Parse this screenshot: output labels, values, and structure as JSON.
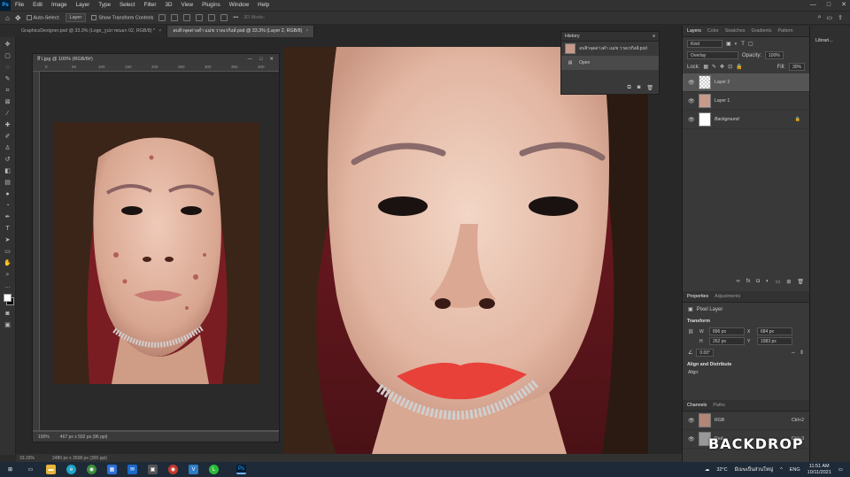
{
  "app": {
    "logo": "Ps"
  },
  "menu": [
    "File",
    "Edit",
    "Image",
    "Layer",
    "Type",
    "Select",
    "Filter",
    "3D",
    "View",
    "Plugins",
    "Window",
    "Help"
  ],
  "window_controls": [
    "—",
    "□",
    "✕"
  ],
  "options": {
    "auto_select_label": "Auto-Select:",
    "auto_select_value": "Layer",
    "show_transform_label": "Show Transform Controls",
    "mode_3d_label": "3D Mode:"
  },
  "tabs": [
    {
      "label": "GraphicsDesigner.psd @ 33.3% (Logo_รูปภาพนอก 02, RGB/8) *",
      "active": false
    },
    {
      "label": "ลบสิวจุดด่างดำ แม่ช วาดเรกิงส์.psd @ 33.3% (Layer 2, RGB/8)",
      "active": true
    }
  ],
  "float_window": {
    "title": "สิว.jpg @ 100% (RGB/8#)",
    "ruler_ticks": [
      "0",
      "50",
      "100",
      "150",
      "200",
      "250",
      "300",
      "350",
      "400"
    ],
    "zoom": "100%",
    "size": "467 px x 592 px (96 ppi)"
  },
  "statusbar": {
    "zoom": "33.33%",
    "size": "2480 px x 3508 px (300 ppi)"
  },
  "history": {
    "title": "History",
    "snapshot": "ลบสิวจุดด่างดำ แม่ช วาดเรกิงส์.psd",
    "step": "Open"
  },
  "layers_panel": {
    "tabs": [
      "Layers",
      "Color",
      "Swatches",
      "Gradients",
      "Pattern"
    ],
    "kind": "Kind",
    "blend_mode": "Overlay",
    "opacity_label": "Opacity:",
    "opacity": "100%",
    "lock_label": "Lock:",
    "fill_label": "Fill:",
    "fill": "30%",
    "layers": [
      {
        "name": "Layer 2",
        "selected": true
      },
      {
        "name": "Layer 1",
        "selected": false
      },
      {
        "name": "Background",
        "selected": false
      }
    ]
  },
  "properties": {
    "tabs": [
      "Properties",
      "Adjustments"
    ],
    "type": "Pixel Layer",
    "transform_title": "Transform",
    "w_label": "W",
    "w": "896 px",
    "h_label": "H",
    "h": "262 px",
    "x_label": "X",
    "x": "684 px",
    "y_label": "Y",
    "y": "1983 px",
    "angle": "0.00°",
    "align_title": "Align and Distribute",
    "align_label": "Align:"
  },
  "channels": {
    "tabs": [
      "Channels",
      "Paths"
    ],
    "items": [
      {
        "name": "RGB",
        "shortcut": "Ctrl+2"
      },
      {
        "name": "Red",
        "shortcut": "Ctrl+3"
      }
    ]
  },
  "libraries_label": "Librari...",
  "watermark": "BACKDROP",
  "taskbar": {
    "weather": "32°C",
    "weather_desc": "มีเมฆเป็นส่วนใหญ่",
    "lang": "ENG",
    "time": "11:51 AM",
    "date": "10/11/2021"
  }
}
